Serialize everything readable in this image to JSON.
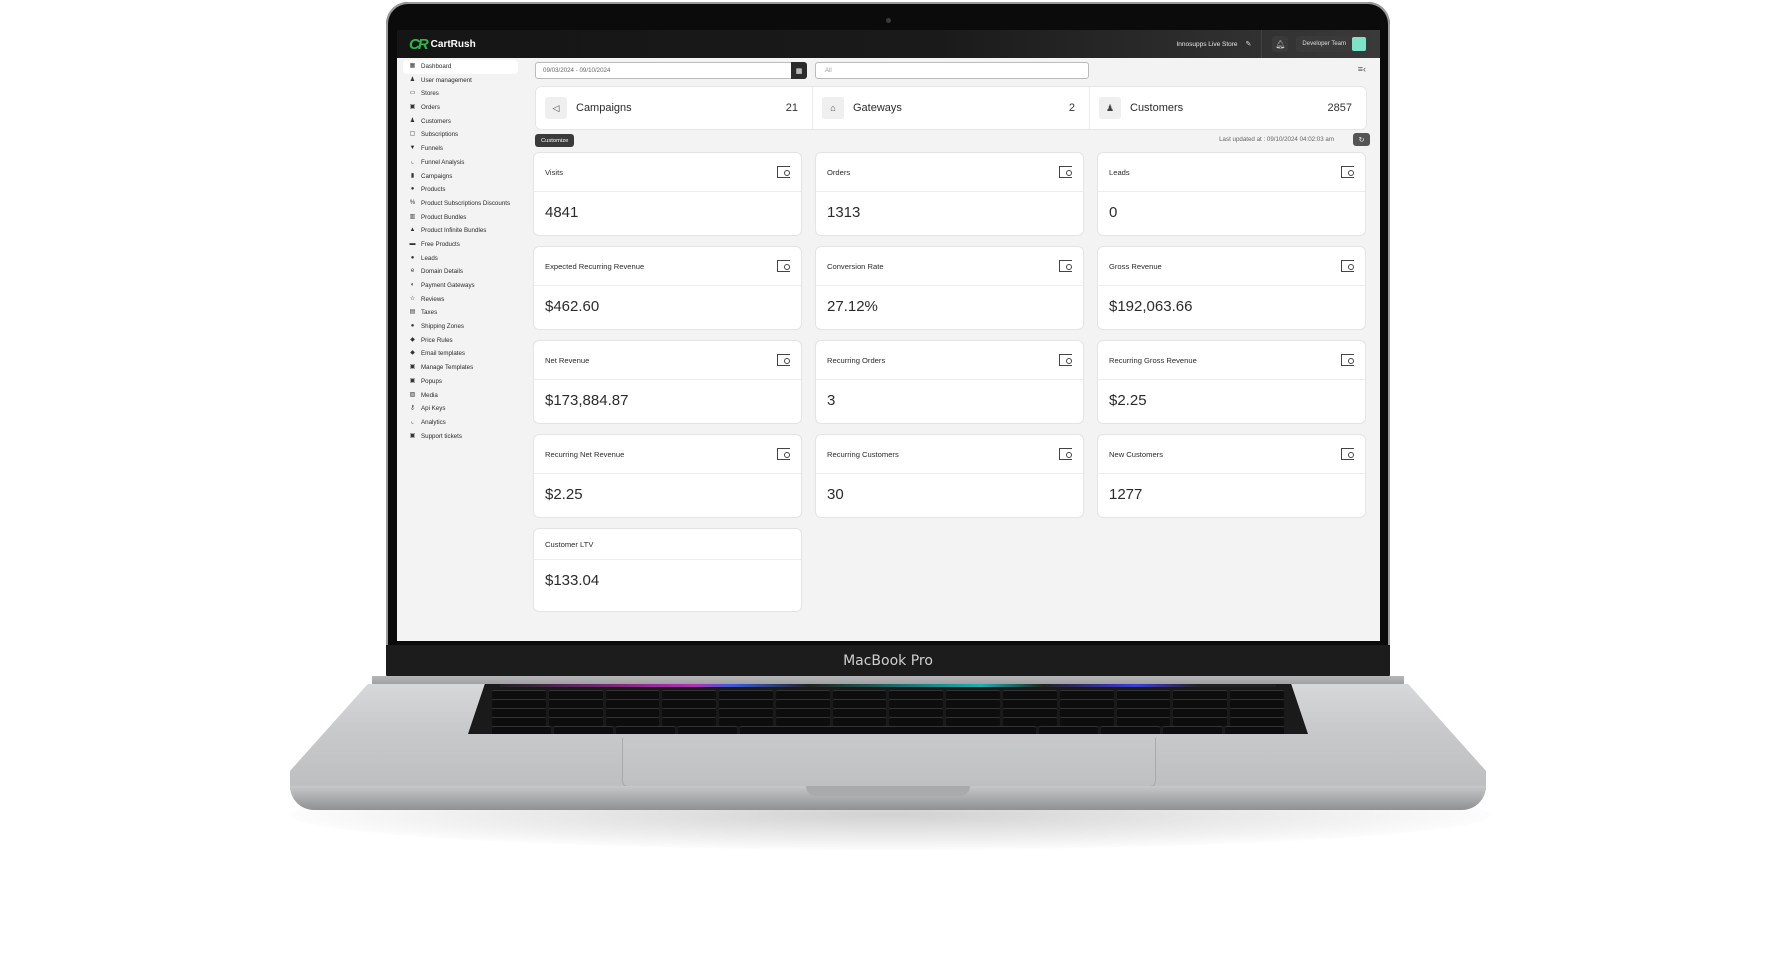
{
  "device": {
    "label": "MacBook Pro"
  },
  "app": {
    "logo_mark": "CR",
    "logo_text": "CartRush",
    "store_name": "Innosupps Live Store",
    "team_name": "Developer Team"
  },
  "sidebar": {
    "items": [
      {
        "label": "Dashboard",
        "icon": "▦",
        "active": true
      },
      {
        "label": "User management",
        "icon": "♟"
      },
      {
        "label": "Stores",
        "icon": "▭"
      },
      {
        "label": "Orders",
        "icon": "▣"
      },
      {
        "label": "Customers",
        "icon": "♟"
      },
      {
        "label": "Subscriptions",
        "icon": "▢"
      },
      {
        "label": "Funnels",
        "icon": "▼"
      },
      {
        "label": "Funnel Analysis",
        "icon": "⌞"
      },
      {
        "label": "Campaigns",
        "icon": "▮"
      },
      {
        "label": "Products",
        "icon": "●"
      },
      {
        "label": "Product Subscriptions Discounts",
        "icon": "%"
      },
      {
        "label": "Product Bundles",
        "icon": "▥"
      },
      {
        "label": "Product Infinite Bundles",
        "icon": "▲"
      },
      {
        "label": "Free Products",
        "icon": "▬"
      },
      {
        "label": "Leads",
        "icon": "●"
      },
      {
        "label": "Domain Details",
        "icon": "e"
      },
      {
        "label": "Payment Gateways",
        "icon": "◐"
      },
      {
        "label": "Reviews",
        "icon": "☆"
      },
      {
        "label": "Taxes",
        "icon": "▤"
      },
      {
        "label": "Shipping Zones",
        "icon": "●"
      },
      {
        "label": "Price Rules",
        "icon": "◆"
      },
      {
        "label": "Email templates",
        "icon": "◆"
      },
      {
        "label": "Manage Templates",
        "icon": "▣"
      },
      {
        "label": "Popups",
        "icon": "▣"
      },
      {
        "label": "Media",
        "icon": "▨"
      },
      {
        "label": "Api Keys",
        "icon": "⚷"
      },
      {
        "label": "Analytics",
        "icon": "⌞"
      },
      {
        "label": "Support tickets",
        "icon": "▣"
      }
    ]
  },
  "filters": {
    "date_range": "09/03/2024 - 09/10/2024",
    "store_select": "All"
  },
  "summary": [
    {
      "label": "Campaigns",
      "count": "21",
      "icon": "megaphone-icon"
    },
    {
      "label": "Gateways",
      "count": "2",
      "icon": "bank-icon"
    },
    {
      "label": "Customers",
      "count": "2857",
      "icon": "users-icon"
    }
  ],
  "toolbar": {
    "customize_label": "Customize",
    "last_updated": "Last updated at : 09/10/2024 04:02:03 am"
  },
  "metrics": [
    {
      "title": "Visits",
      "value": "4841"
    },
    {
      "title": "Orders",
      "value": "1313"
    },
    {
      "title": "Leads",
      "value": "0"
    },
    {
      "title": "Expected Recurring Revenue",
      "value": "$462.60"
    },
    {
      "title": "Conversion Rate",
      "value": "27.12%"
    },
    {
      "title": "Gross Revenue",
      "value": "$192,063.66"
    },
    {
      "title": "Net Revenue",
      "value": "$173,884.87"
    },
    {
      "title": "Recurring Orders",
      "value": "3"
    },
    {
      "title": "Recurring Gross Revenue",
      "value": "$2.25"
    },
    {
      "title": "Recurring Net Revenue",
      "value": "$2.25"
    },
    {
      "title": "Recurring Customers",
      "value": "30"
    },
    {
      "title": "New Customers",
      "value": "1277"
    },
    {
      "title": "Customer LTV",
      "value": "$133.04"
    }
  ]
}
